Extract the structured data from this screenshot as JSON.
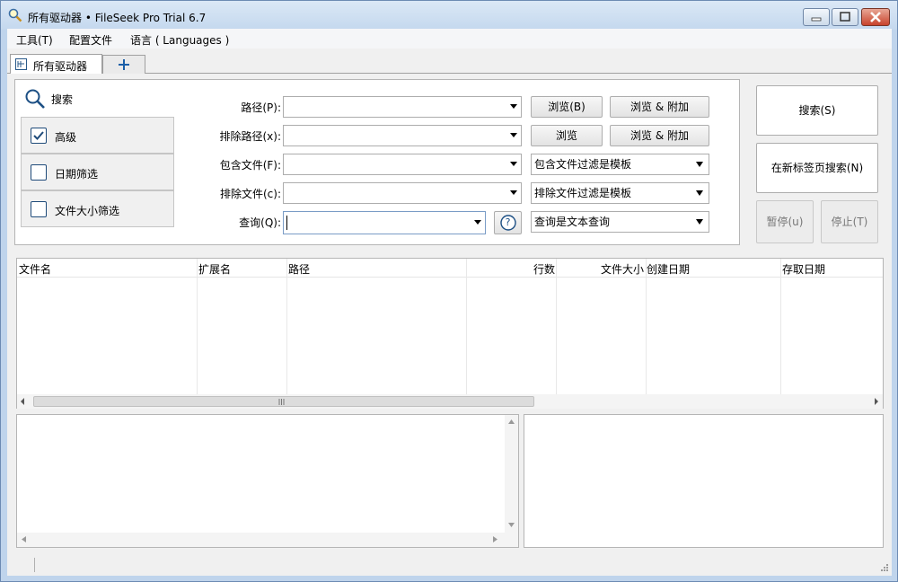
{
  "window": {
    "title": "所有驱动器 • FileSeek Pro Trial 6.7"
  },
  "menu": [
    {
      "label": "工具(T)"
    },
    {
      "label": "配置文件"
    },
    {
      "label": "语言 ( Languages )"
    }
  ],
  "tabs": [
    {
      "label": "所有驱动器"
    }
  ],
  "side_tabs": {
    "search": "搜索",
    "items": [
      {
        "label": "高级",
        "checked": true
      },
      {
        "label": "日期筛选",
        "checked": false
      },
      {
        "label": "文件大小筛选",
        "checked": false
      }
    ]
  },
  "form": {
    "path_label": "路径(P):",
    "exclude_path_label": "排除路径(x):",
    "include_files_label": "包含文件(F):",
    "exclude_files_label": "排除文件(c):",
    "query_label": "查询(Q):",
    "path_value": "",
    "exclude_path_value": "",
    "include_files_value": "",
    "exclude_files_value": "",
    "query_value": "",
    "include_mode": "包含文件过滤是模板",
    "exclude_mode": "排除文件过滤是模板",
    "query_mode": "查询是文本查询"
  },
  "buttons": {
    "browse_b": "浏览(B)",
    "browse_add_1": "浏览 & 附加",
    "browse": "浏览",
    "browse_add_2": "浏览 & 附加",
    "search": "搜索(S)",
    "search_new_tab": "在新标签页搜索(N)",
    "pause": "暂停(u)",
    "stop": "停止(T)",
    "help": "?"
  },
  "results": {
    "columns": [
      "文件名",
      "扩展名",
      "路径",
      "行数",
      "文件大小",
      "创建日期",
      "存取日期"
    ]
  }
}
